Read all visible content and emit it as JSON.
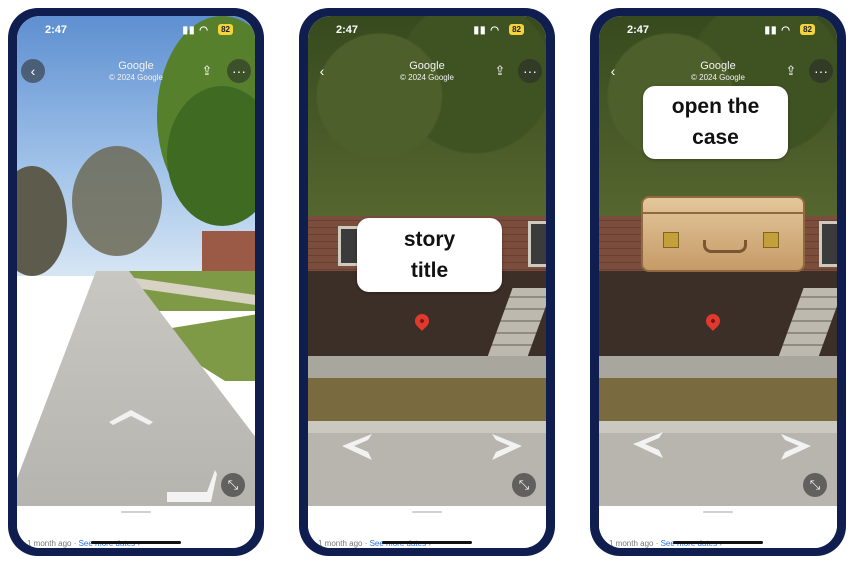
{
  "phones": [
    {
      "status": {
        "time": "2:47",
        "battery": "82"
      },
      "header": {
        "title": "Google",
        "subtitle": "© 2024 Google"
      },
      "footer": {
        "date_text": "1 month ago · ",
        "link": "See more dates"
      }
    },
    {
      "status": {
        "time": "2:47",
        "battery": "82"
      },
      "header": {
        "title": "Google",
        "subtitle": "© 2024 Google"
      },
      "overlay": {
        "line1": "story",
        "line2": "title"
      },
      "footer": {
        "date_text": "1 month ago · ",
        "link": "See more dates"
      }
    },
    {
      "status": {
        "time": "2:47",
        "battery": "82"
      },
      "header": {
        "title": "Google",
        "subtitle": "© 2024 Google"
      },
      "overlay": {
        "line1": "open the",
        "line2": "case"
      },
      "footer": {
        "date_text": "1 month ago · ",
        "link": "See more dates"
      }
    }
  ],
  "icons": {
    "back": "chevron-left-icon",
    "share": "share-icon",
    "more": "more-dots-icon",
    "location": "location-arrow-icon",
    "wifi": "wifi-icon",
    "collapse": "collapse-arrows-icon",
    "pin": "map-pin-icon",
    "chevron": "chevron-right-icon"
  },
  "colors": {
    "frame": "#0f1d4f",
    "link": "#2a73e6",
    "pin": "#e03a2f",
    "battery": "#f4d33c"
  }
}
